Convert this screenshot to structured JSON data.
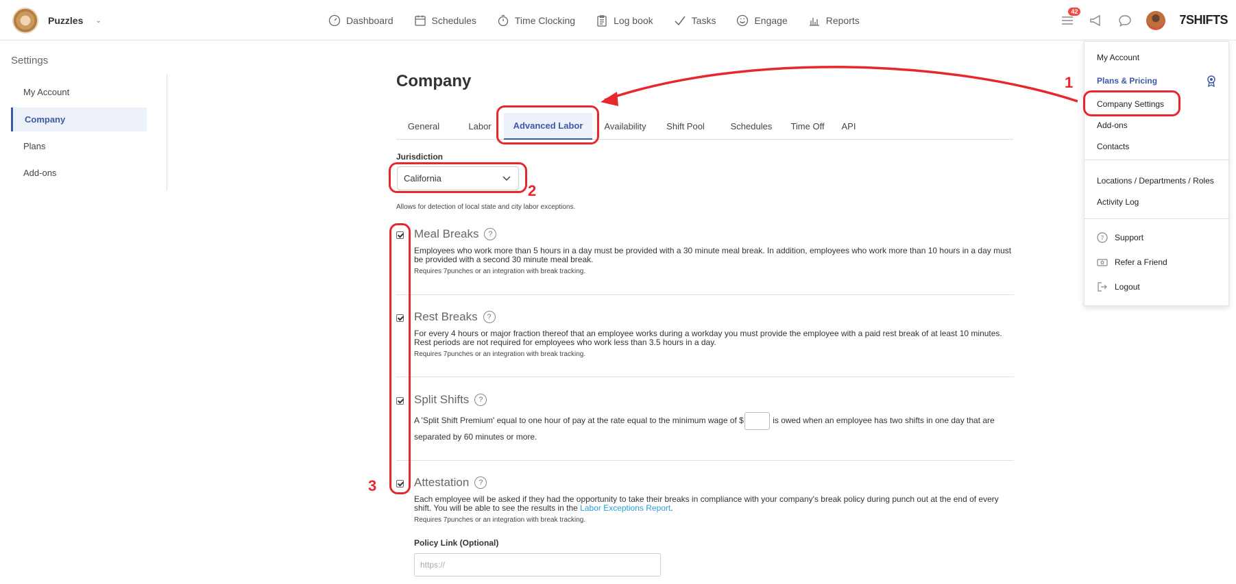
{
  "header": {
    "org_name": "Puzzles",
    "nav": [
      "Dashboard",
      "Schedules",
      "Time Clocking",
      "Log book",
      "Tasks",
      "Engage",
      "Reports"
    ],
    "notification_count": "42",
    "logo_text": "7SHIFTS"
  },
  "sidebar": {
    "title": "Settings",
    "items": [
      "My Account",
      "Company",
      "Plans",
      "Add-ons"
    ],
    "active": "Company"
  },
  "main": {
    "title": "Company",
    "tabs": [
      "General",
      "Labor",
      "Advanced Labor",
      "Availability",
      "Shift Pool",
      "Schedules",
      "Time Off",
      "API"
    ],
    "active_tab": "Advanced Labor",
    "jurisdiction": {
      "label": "Jurisdiction",
      "value": "California",
      "hint": "Allows for detection of local state and city labor exceptions."
    },
    "sections": [
      {
        "title": "Meal Breaks",
        "checked": true,
        "description": "Employees who work more than 5 hours in a day must be provided with a 30 minute meal break. In addition, employees who work more than 10 hours in a day must be provided with a second 30 minute meal break.",
        "note": "Requires 7punches or an integration with break tracking."
      },
      {
        "title": "Rest Breaks",
        "checked": true,
        "description": "For every 4 hours or major fraction thereof that an employee works during a workday you must provide the employee with a paid rest break of at least 10 minutes. Rest periods are not required for employees who work less than 3.5 hours in a day.",
        "note": "Requires 7punches or an integration with break tracking."
      },
      {
        "title": "Split Shifts",
        "checked": true,
        "description_before": "A 'Split Shift Premium' equal to one hour of pay at the rate equal to the minimum wage of $",
        "description_after": "is owed when an employee has two shifts in one day that are separated by 60 minutes or more."
      },
      {
        "title": "Attestation",
        "checked": true,
        "description": "Each employee will be asked if they had the opportunity to take their breaks in compliance with your company's break policy during punch out at the end of every shift. You will be able to see the results in the",
        "link_text": "Labor Exceptions Report",
        "description_end": ".",
        "note": "Requires 7punches or an integration with break tracking."
      }
    ],
    "policy": {
      "label": "Policy Link (Optional)",
      "placeholder": "https://"
    }
  },
  "user_menu": {
    "items": [
      "My Account",
      "Plans & Pricing",
      "Company Settings",
      "Add-ons",
      "Contacts"
    ],
    "items2": [
      "Locations / Departments / Roles",
      "Activity Log"
    ],
    "items3": [
      "Support",
      "Refer a Friend",
      "Logout"
    ]
  },
  "annotations": [
    "1",
    "2",
    "3"
  ],
  "colors": {
    "accent": "#3b5aa6",
    "annotation": "#e8262b",
    "link": "#26a0d6",
    "badge": "#f04b3e"
  }
}
